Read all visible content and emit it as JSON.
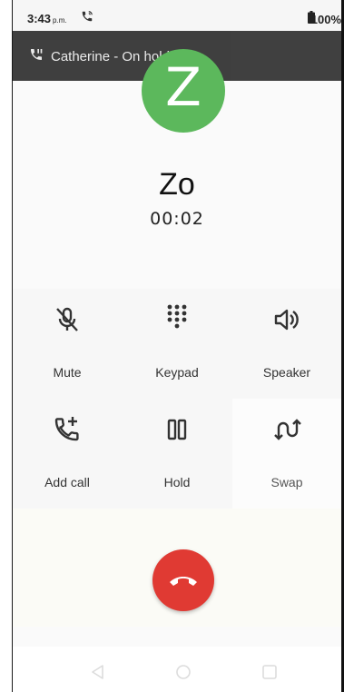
{
  "status": {
    "time": "3:43",
    "ampm": "p.m.",
    "battery": "100%"
  },
  "hold_banner": {
    "text": "Catherine - On hold"
  },
  "caller": {
    "initial": "Z",
    "name": "Zo",
    "timer": "00:02"
  },
  "controls": [
    {
      "label": "Mute",
      "icon": "mic-off-icon"
    },
    {
      "label": "Keypad",
      "icon": "dialpad-icon"
    },
    {
      "label": "Speaker",
      "icon": "speaker-icon"
    },
    {
      "label": "Add call",
      "icon": "add-call-icon"
    },
    {
      "label": "Hold",
      "icon": "pause-icon"
    },
    {
      "label": "Swap",
      "icon": "swap-icon"
    }
  ],
  "end_call": {
    "icon": "call-end-icon"
  },
  "navigation": {
    "icons": [
      "back-icon",
      "home-icon",
      "recents-icon"
    ]
  },
  "colors": {
    "avatar": "#5cb85c",
    "end_call": "#e03a33",
    "banner": "#3c3c3c"
  }
}
